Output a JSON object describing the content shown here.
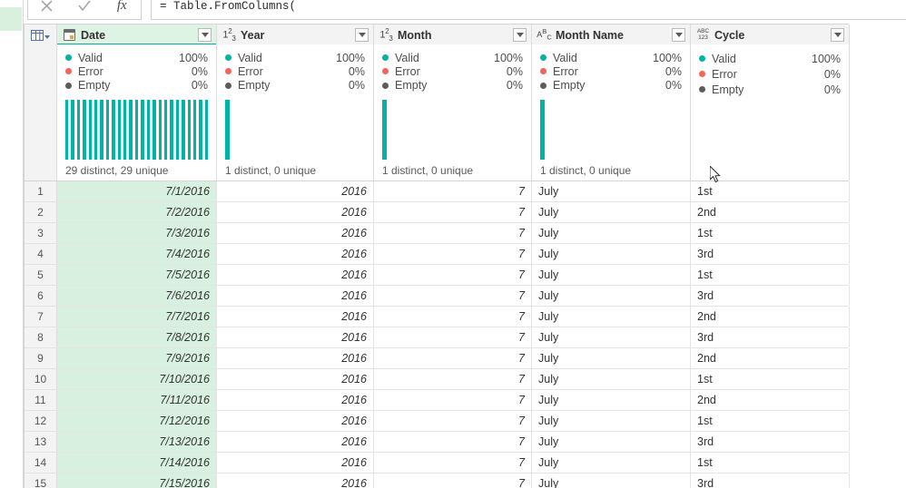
{
  "formula_bar": {
    "cancel_icon": "close-icon",
    "accept_icon": "check-icon",
    "fx_label": "fx",
    "value": "= Table.FromColumns("
  },
  "table": {
    "row_selector_icon": "table-menu-icon",
    "columns": [
      {
        "name": "Date",
        "type_icon": "date-icon",
        "selected": true,
        "filter_icon": "chevron-down-icon",
        "quality": {
          "valid_label": "Valid",
          "valid_value": "100%",
          "error_label": "Error",
          "error_value": "0%",
          "empty_label": "Empty",
          "empty_value": "0%"
        },
        "distribution_bars": 25,
        "footer": "29 distinct, 29 unique"
      },
      {
        "name": "Year",
        "type_icon": "whole-number-icon",
        "selected": false,
        "filter_icon": "chevron-down-icon",
        "quality": {
          "valid_label": "Valid",
          "valid_value": "100%",
          "error_label": "Error",
          "error_value": "0%",
          "empty_label": "Empty",
          "empty_value": "0%"
        },
        "distribution_bars": 1,
        "footer": "1 distinct, 0 unique"
      },
      {
        "name": "Month",
        "type_icon": "whole-number-icon",
        "selected": false,
        "filter_icon": "chevron-down-icon",
        "quality": {
          "valid_label": "Valid",
          "valid_value": "100%",
          "error_label": "Error",
          "error_value": "0%",
          "empty_label": "Empty",
          "empty_value": "0%"
        },
        "distribution_bars": 1,
        "footer": "1 distinct, 0 unique"
      },
      {
        "name": "Month Name",
        "type_icon": "text-icon",
        "selected": false,
        "filter_icon": "chevron-down-icon",
        "quality": {
          "valid_label": "Valid",
          "valid_value": "100%",
          "error_label": "Error",
          "error_value": "0%",
          "empty_label": "Empty",
          "empty_value": "0%"
        },
        "distribution_bars": 1,
        "footer": "1 distinct, 0 unique"
      },
      {
        "name": "Cycle",
        "type_icon": "any-type-icon",
        "selected": false,
        "filter_icon": "chevron-down-icon",
        "quality": {
          "valid_label": "Valid",
          "valid_value": "100%",
          "error_label": "Error",
          "error_value": "0%",
          "empty_label": "Empty",
          "empty_value": "0%"
        },
        "distribution_bars": 0,
        "footer": ""
      }
    ],
    "rows": [
      {
        "n": "1",
        "date": "7/1/2016",
        "year": "2016",
        "month": "7",
        "month_name": "July",
        "cycle": "1st"
      },
      {
        "n": "2",
        "date": "7/2/2016",
        "year": "2016",
        "month": "7",
        "month_name": "July",
        "cycle": "2nd"
      },
      {
        "n": "3",
        "date": "7/3/2016",
        "year": "2016",
        "month": "7",
        "month_name": "July",
        "cycle": "1st"
      },
      {
        "n": "4",
        "date": "7/4/2016",
        "year": "2016",
        "month": "7",
        "month_name": "July",
        "cycle": "3rd"
      },
      {
        "n": "5",
        "date": "7/5/2016",
        "year": "2016",
        "month": "7",
        "month_name": "July",
        "cycle": "1st"
      },
      {
        "n": "6",
        "date": "7/6/2016",
        "year": "2016",
        "month": "7",
        "month_name": "July",
        "cycle": "3rd"
      },
      {
        "n": "7",
        "date": "7/7/2016",
        "year": "2016",
        "month": "7",
        "month_name": "July",
        "cycle": "2nd"
      },
      {
        "n": "8",
        "date": "7/8/2016",
        "year": "2016",
        "month": "7",
        "month_name": "July",
        "cycle": "3rd"
      },
      {
        "n": "9",
        "date": "7/9/2016",
        "year": "2016",
        "month": "7",
        "month_name": "July",
        "cycle": "2nd"
      },
      {
        "n": "10",
        "date": "7/10/2016",
        "year": "2016",
        "month": "7",
        "month_name": "July",
        "cycle": "1st"
      },
      {
        "n": "11",
        "date": "7/11/2016",
        "year": "2016",
        "month": "7",
        "month_name": "July",
        "cycle": "2nd"
      },
      {
        "n": "12",
        "date": "7/12/2016",
        "year": "2016",
        "month": "7",
        "month_name": "July",
        "cycle": "1st"
      },
      {
        "n": "13",
        "date": "7/13/2016",
        "year": "2016",
        "month": "7",
        "month_name": "July",
        "cycle": "3rd"
      },
      {
        "n": "14",
        "date": "7/14/2016",
        "year": "2016",
        "month": "7",
        "month_name": "July",
        "cycle": "1st"
      },
      {
        "n": "15",
        "date": "7/15/2016",
        "year": "2016",
        "month": "7",
        "month_name": "July",
        "cycle": "3rd"
      }
    ]
  },
  "colors": {
    "valid": "#00b3a4",
    "error": "#f4645c",
    "empty": "#5d5d5d",
    "selection": "#d8f0df",
    "header_accent": "#00b0a0"
  }
}
